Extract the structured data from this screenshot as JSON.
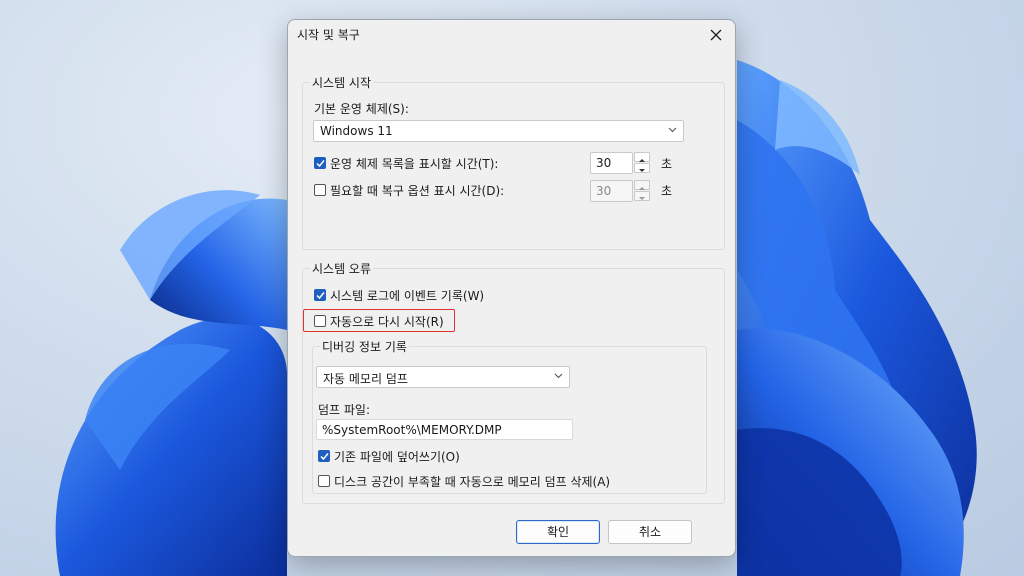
{
  "dialog": {
    "title": "시작 및 복구",
    "ok_label": "확인",
    "cancel_label": "취소"
  },
  "system_startup": {
    "group_label": "시스템 시작",
    "default_os_label": "기본 운영 체제(S):",
    "default_os_value": "Windows 11",
    "show_os_list_label": "운영 체제 목록을 표시할 시간(T):",
    "show_os_list_checked": true,
    "show_os_list_value": "30",
    "show_recovery_label": "필요할 때 복구 옵션 표시 시간(D):",
    "show_recovery_checked": false,
    "show_recovery_value": "30",
    "unit_seconds": "초"
  },
  "system_failure": {
    "group_label": "시스템 오류",
    "write_event_label": "시스템 로그에 이벤트 기록(W)",
    "write_event_checked": true,
    "auto_restart_label": "자동으로 다시 시작(R)",
    "auto_restart_checked": false,
    "debug": {
      "group_label": "디버깅 정보 기록",
      "dump_type_value": "자동 메모리 덤프",
      "dump_file_label": "덤프 파일:",
      "dump_file_value": "%SystemRoot%\\MEMORY.DMP",
      "overwrite_label": "기존 파일에 덮어쓰기(O)",
      "overwrite_checked": true,
      "disable_autodelete_label": "디스크 공간이 부족할 때 자동으로 메모리 덤프 삭제(A)",
      "disable_autodelete_checked": false
    }
  },
  "colors": {
    "accent": "#1f5fbf",
    "highlight": "#e13232",
    "wallpaper_blue": "#1e56d6"
  }
}
